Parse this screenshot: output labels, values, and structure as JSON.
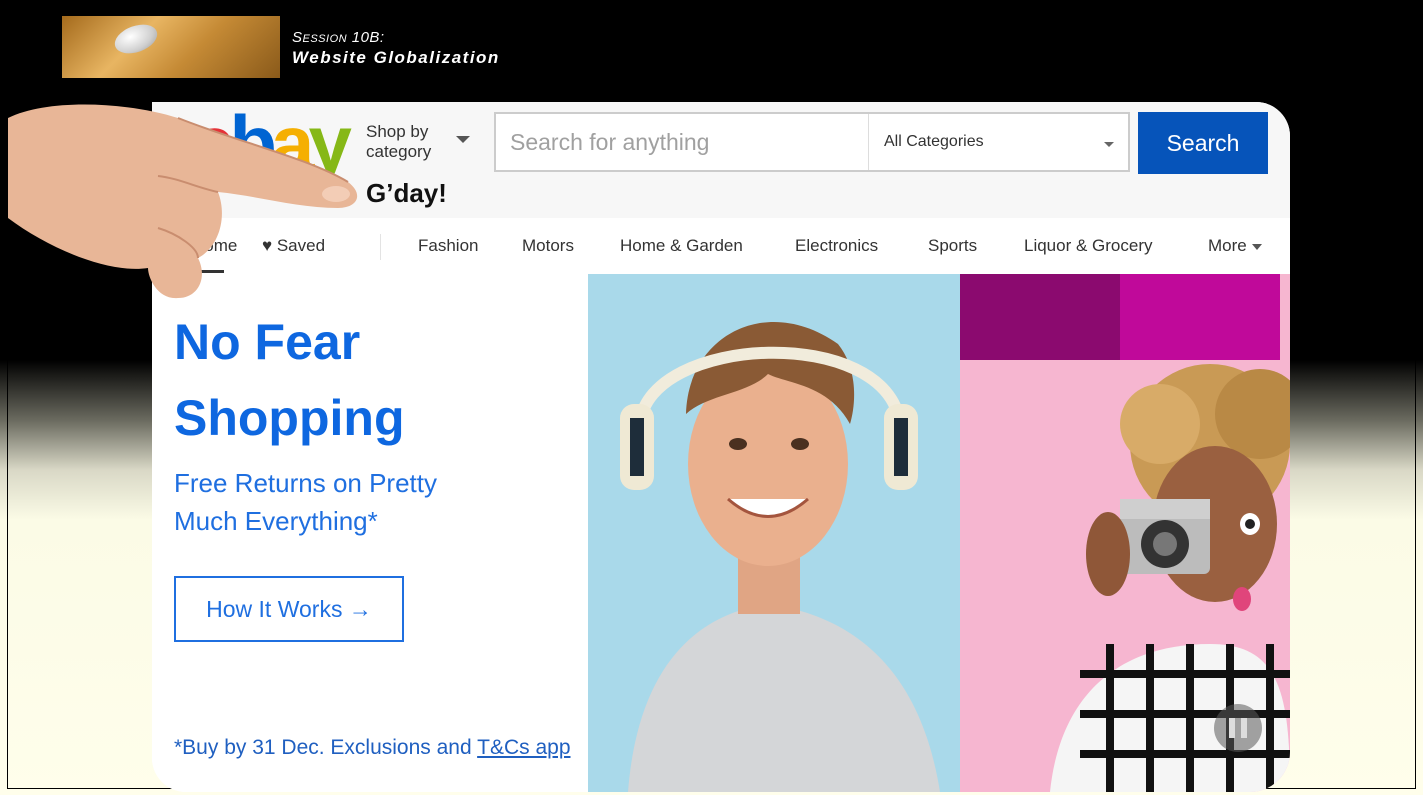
{
  "slide": {
    "session_label": "Session 10B:",
    "session_title": "Website Globalization"
  },
  "ebay": {
    "logo": {
      "e": "e",
      "b": "b",
      "a": "a",
      "y": "y"
    },
    "shop_by_line1": "Shop by",
    "shop_by_line2": "category",
    "greeting": "G’day!",
    "search": {
      "placeholder": "Search for anything",
      "category": "All Categories",
      "button": "Search"
    },
    "nav": {
      "home": "Home",
      "saved": "Saved",
      "items": [
        "Fashion",
        "Motors",
        "Home & Garden",
        "Electronics",
        "Sports",
        "Liquor & Grocery"
      ],
      "more": "More"
    },
    "hero": {
      "headline_line1": "No Fear",
      "headline_line2": "Shopping",
      "subhead_line1": "Free Returns on Pretty",
      "subhead_line2": "Much Everything*",
      "cta": "How It Works →",
      "disclaimer_prefix": "*Buy by 31 Dec. Exclusions and ",
      "disclaimer_link": "T&Cs app"
    },
    "colors": {
      "brand_blue": "#0654ba",
      "hero_text": "#0e67e0",
      "logo_red": "#e53238",
      "logo_blue": "#0064d2",
      "logo_yellow": "#f5af02",
      "logo_green": "#86b817"
    }
  }
}
